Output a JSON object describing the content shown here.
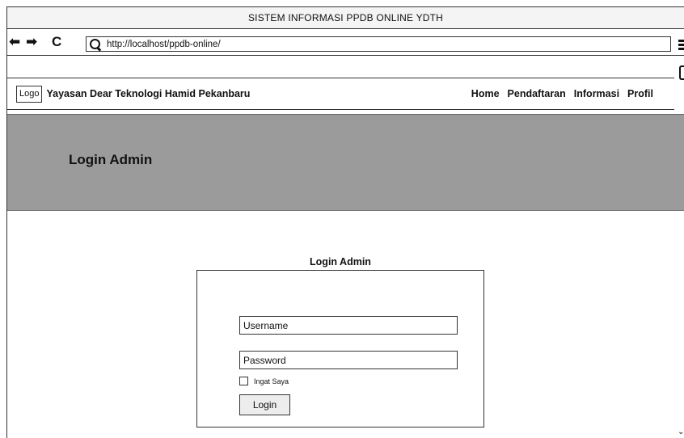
{
  "window": {
    "title": "SISTEM INFORMASI PPDB ONLINE YDTH"
  },
  "browser": {
    "back_icon": "arrow-left-icon",
    "forward_icon": "arrow-right-icon",
    "reload_icon": "reload-icon",
    "back_glyph": "⬅",
    "forward_glyph": "➡",
    "reload_glyph": "C",
    "url": "http://localhost/ppdb-online/",
    "menu_icon": "hamburger-menu-icon"
  },
  "header": {
    "logo": "Logo",
    "site_name": "Yayasan Dear Teknologi Hamid Pekanbaru",
    "nav": [
      "Home",
      "Pendaftaran",
      "Informasi",
      "Profil"
    ]
  },
  "hero": {
    "title": "Login Admin"
  },
  "login": {
    "title": "Login Admin",
    "username_placeholder": "Username",
    "password_placeholder": "Password",
    "remember_label": "Ingat Saya",
    "submit_label": "Login"
  },
  "colors": {
    "hero_bg": "#9b9b9b",
    "button_bg": "#ededed",
    "border": "#333333"
  }
}
